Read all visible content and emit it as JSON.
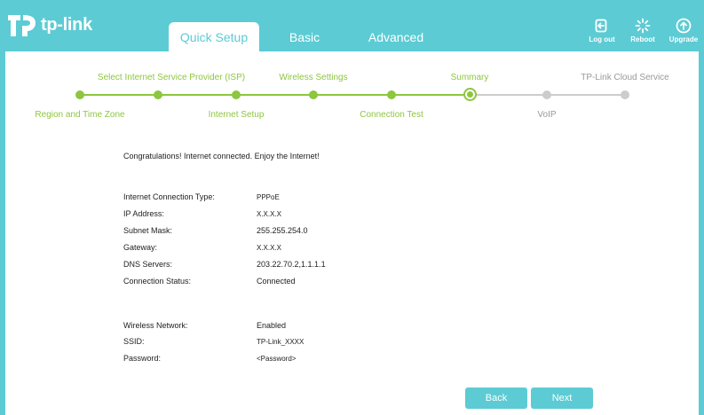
{
  "brand": {
    "name": "tp-link",
    "accent": "#5ccbd4"
  },
  "nav": {
    "tabs": [
      {
        "label": "Quick Setup",
        "active": true
      },
      {
        "label": "Basic",
        "active": false
      },
      {
        "label": "Advanced",
        "active": false
      }
    ]
  },
  "header_actions": [
    {
      "label": "Log out",
      "icon": "logout-icon"
    },
    {
      "label": "Reboot",
      "icon": "reboot-icon"
    },
    {
      "label": "Upgrade",
      "icon": "upgrade-icon"
    }
  ],
  "stepper": {
    "active_color": "#8dc63f",
    "inactive_color": "#cccccc",
    "steps": [
      {
        "label": "Region and Time Zone",
        "state": "done"
      },
      {
        "label": "Select Internet Service Provider (ISP)",
        "state": "done"
      },
      {
        "label": "Internet Setup",
        "state": "done"
      },
      {
        "label": "Wireless Settings",
        "state": "done"
      },
      {
        "label": "Connection Test",
        "state": "done"
      },
      {
        "label": "Summary",
        "state": "current"
      },
      {
        "label": "VoIP",
        "state": "todo"
      },
      {
        "label": "TP-Link Cloud Service",
        "state": "todo"
      }
    ]
  },
  "summary": {
    "congrats": "Congratulations! Internet connected. Enjoy the Internet!",
    "internet": [
      {
        "label": "Internet Connection Type:",
        "value": "PPPoE"
      },
      {
        "label": "IP Address:",
        "value": "X.X.X.X"
      },
      {
        "label": "Subnet Mask:",
        "value": "255.255.254.0"
      },
      {
        "label": "Gateway:",
        "value": "X.X.X.X"
      },
      {
        "label": "DNS Servers:",
        "value": "203.22.70.2,1.1.1.1"
      },
      {
        "label": "Connection Status:",
        "value": "Connected"
      }
    ],
    "wireless": [
      {
        "label": "Wireless Network:",
        "value": "Enabled"
      },
      {
        "label": "SSID:",
        "value": "TP-Link_XXXX"
      },
      {
        "label": "Password:",
        "value": "<Password>"
      }
    ]
  },
  "buttons": {
    "back": "Back",
    "next": "Next"
  }
}
